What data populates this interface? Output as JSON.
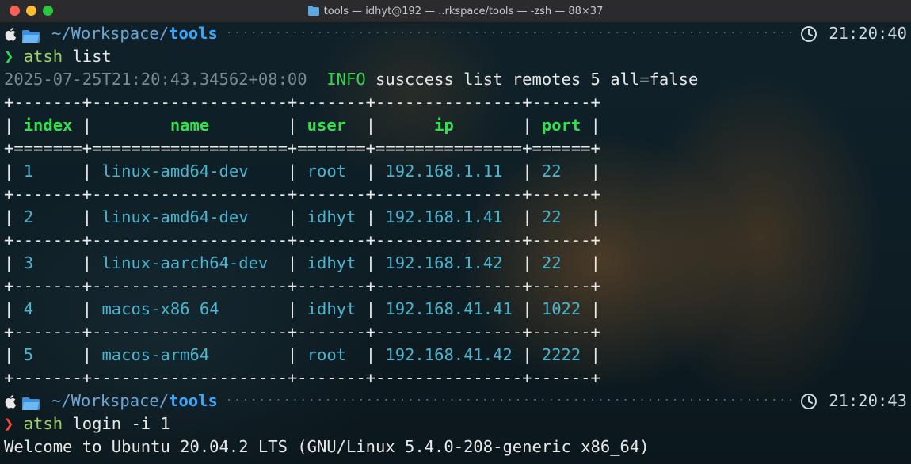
{
  "window": {
    "title": "tools — idhyt@192 — ..rkspace/tools — -zsh — 88×37"
  },
  "prompts": [
    {
      "path_prefix": "~/Workspace/",
      "path_dir": "tools",
      "time": "21:20:40",
      "chevron": "❯",
      "cmd": "atsh",
      "args": " list",
      "status": "success"
    },
    {
      "path_prefix": "~/Workspace/",
      "path_dir": "tools",
      "time": "21:20:43",
      "chevron": "❯",
      "cmd": "atsh",
      "args": " login -i 1",
      "status": "error"
    }
  ],
  "log": {
    "timestamp": "2025-07-25T21:20:43.34562+08:00",
    "level": "INFO",
    "message": " susccess list remotes 5 all",
    "eq": "=",
    "value": "false"
  },
  "table": {
    "border": "+-------+--------------------+-------+---------------+------+",
    "header_sep": "+=======+====================+=======+===============+======+",
    "columns": [
      "index",
      "name",
      "user",
      "ip",
      "port"
    ],
    "rows": [
      [
        "1",
        "linux-amd64-dev",
        "root",
        "192.168.1.11",
        "22"
      ],
      [
        "2",
        "linux-amd64-dev",
        "idhyt",
        "192.168.1.41",
        "22"
      ],
      [
        "3",
        "linux-aarch64-dev",
        "idhyt",
        "192.168.1.42",
        "22"
      ],
      [
        "4",
        "macos-x86_64",
        "idhyt",
        "192.168.41.41",
        "1022"
      ],
      [
        "5",
        "macos-arm64",
        "root",
        "192.168.41.42",
        "2222"
      ]
    ]
  },
  "welcome": "Welcome to Ubuntu 20.04.2 LTS (GNU/Linux 5.4.0-208-generic x86_64)",
  "colors": {
    "ok_chevron": "#32d74b",
    "err_chevron": "#ff453a",
    "header": "#32e04e",
    "cell": "#4ab5ce",
    "path": "#39a7ff"
  }
}
